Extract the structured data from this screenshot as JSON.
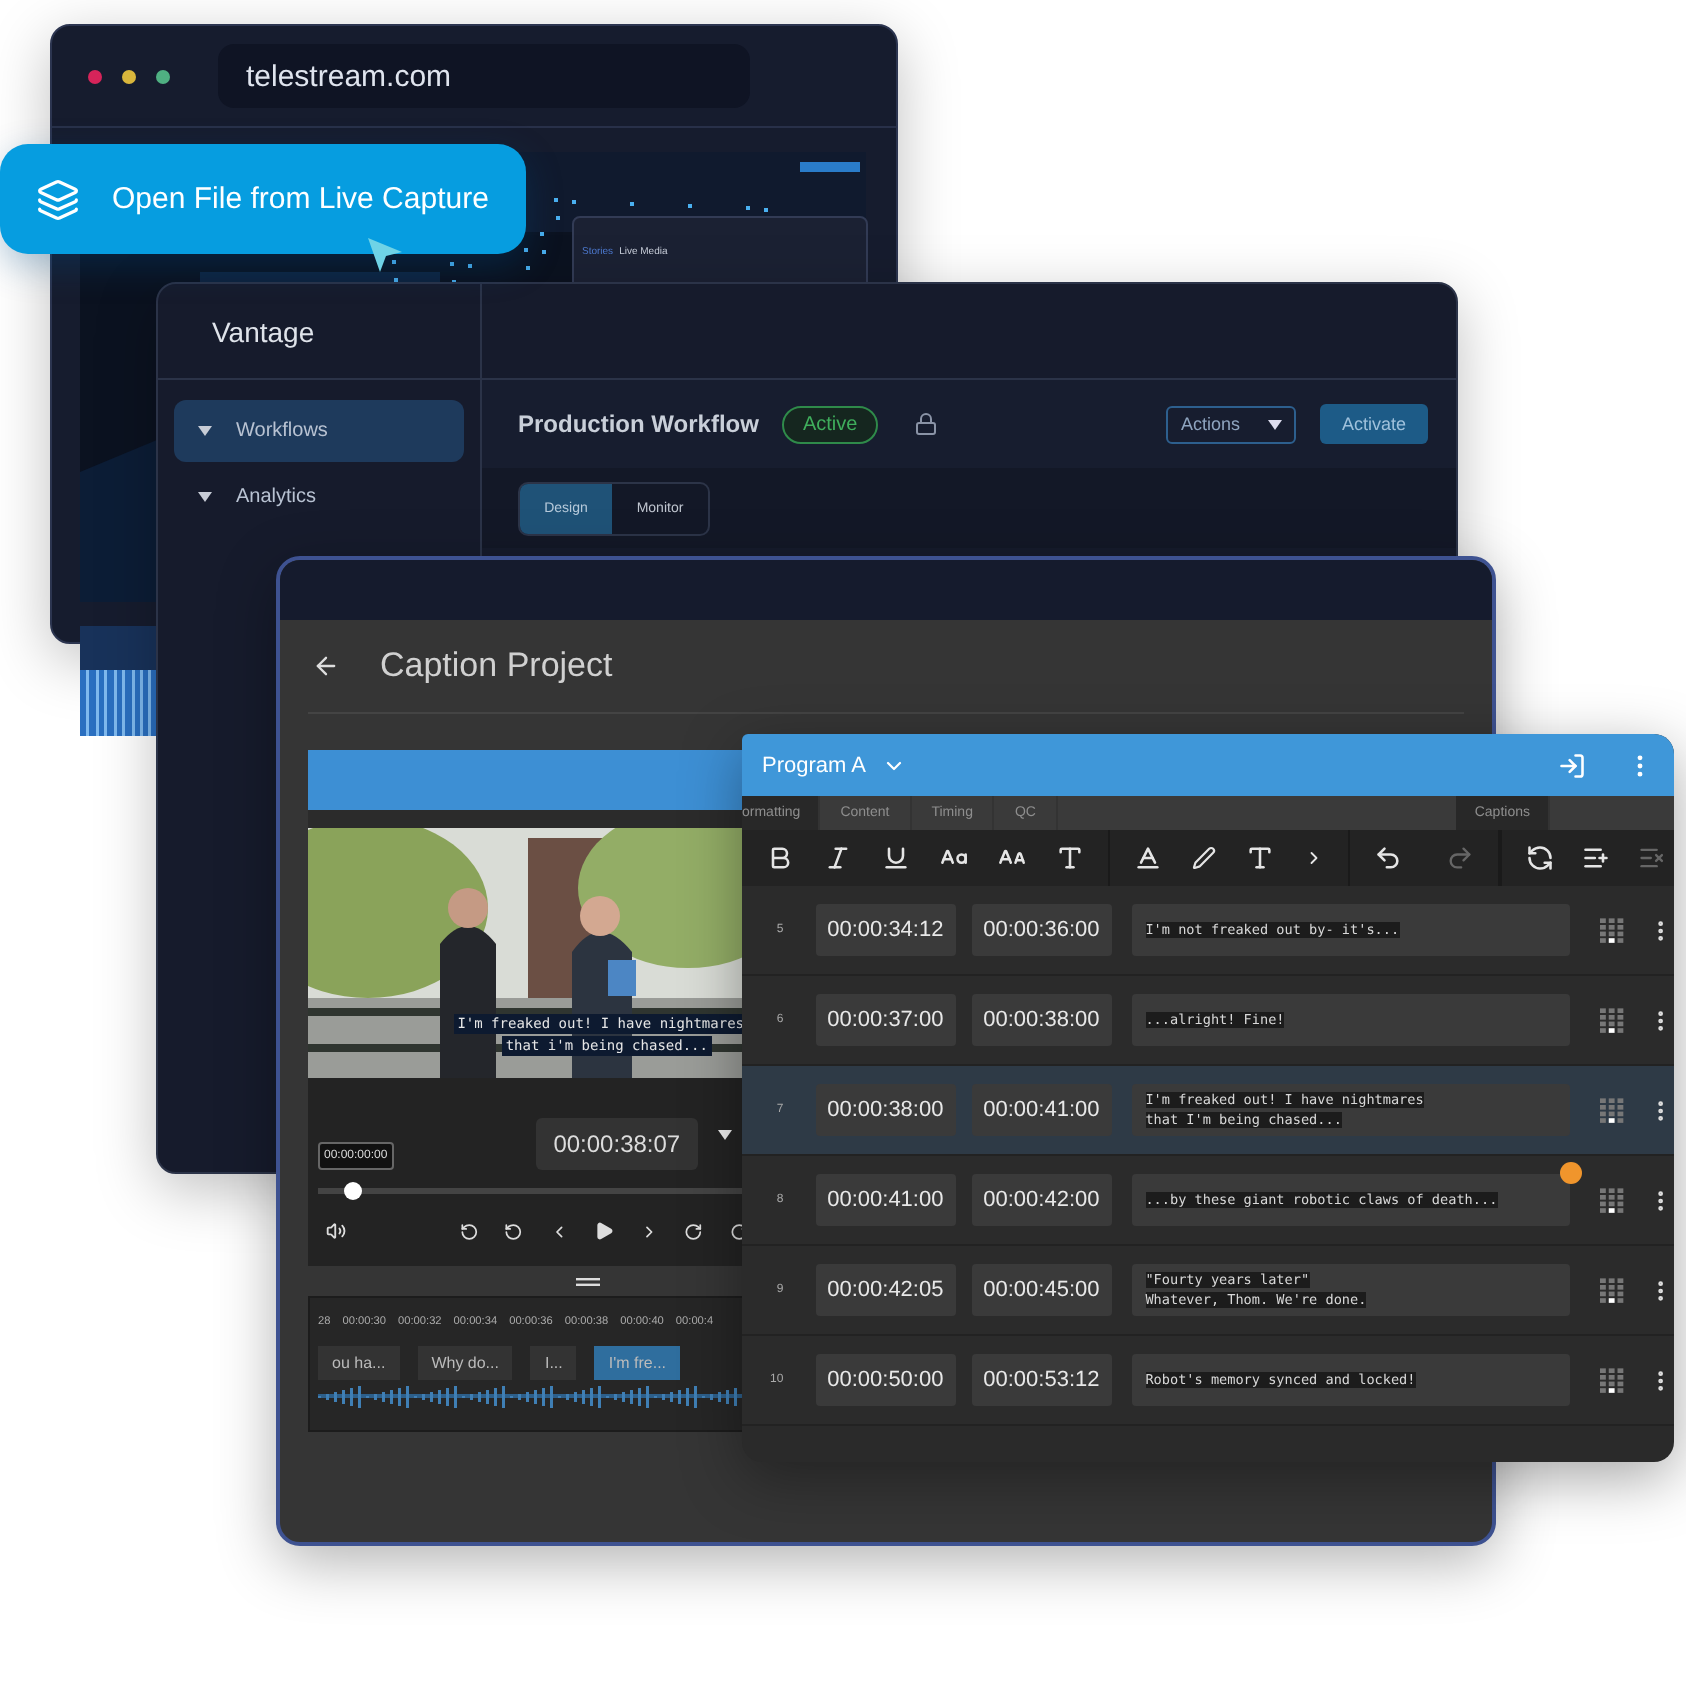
{
  "browser": {
    "url": "telestream.com",
    "breadcrumb": [
      "Stories",
      "Live Media"
    ]
  },
  "callout": {
    "label": "Open File from Live Capture"
  },
  "vantage": {
    "title": "Vantage",
    "sidebar": [
      {
        "label": "Workflows",
        "selected": true
      },
      {
        "label": "Analytics",
        "selected": false
      }
    ],
    "workflow_title": "Production Workflow",
    "status": "Active",
    "actions": "Actions",
    "activate": "Activate",
    "tabs": [
      {
        "label": "Design",
        "selected": true
      },
      {
        "label": "Monitor",
        "selected": false
      }
    ]
  },
  "caption_project": {
    "title": "Caption Project",
    "overlay": [
      "I'm freaked out! I have nightmares",
      "that i'm being chased..."
    ],
    "start_timecode": "00:00:00:00",
    "current_timecode": "00:00:38:07",
    "scrub": {
      "level": 0.08
    },
    "ticks": [
      "28",
      "00:00:30",
      "00:00:32",
      "00:00:34",
      "00:00:36",
      "00:00:38",
      "00:00:40",
      "00:00:4"
    ],
    "clips": [
      {
        "label": "ou ha...",
        "selected": false
      },
      {
        "label": "Why do...",
        "selected": false
      },
      {
        "label": "I...",
        "selected": false
      },
      {
        "label": "I'm fre...",
        "selected": true
      }
    ]
  },
  "program": {
    "name": "Program A",
    "tabs": [
      {
        "label": "ormatting",
        "selected": true
      },
      {
        "label": "Content",
        "selected": false
      },
      {
        "label": "Timing",
        "selected": false
      },
      {
        "label": "QC",
        "selected": false
      }
    ],
    "side_tab": {
      "label": "Captions",
      "selected": true
    },
    "rows": [
      {
        "index": "5",
        "start": "00:00:34:12",
        "end": "00:00:36:00",
        "lines": [
          "I'm not freaked out by- it's..."
        ],
        "selected": false,
        "warning": false
      },
      {
        "index": "6",
        "start": "00:00:37:00",
        "end": "00:00:38:00",
        "lines": [
          "...alright! Fine!"
        ],
        "selected": false,
        "warning": false
      },
      {
        "index": "7",
        "start": "00:00:38:00",
        "end": "00:00:41:00",
        "lines": [
          "I'm freaked out! I have nightmares",
          "that I'm being chased..."
        ],
        "selected": true,
        "warning": false
      },
      {
        "index": "8",
        "start": "00:00:41:00",
        "end": "00:00:42:00",
        "lines": [
          "...by these giant robotic claws of death..."
        ],
        "selected": false,
        "warning": true
      },
      {
        "index": "9",
        "start": "00:00:42:05",
        "end": "00:00:45:00",
        "lines": [
          "\"Fourty years later\"",
          "Whatever, Thom. We're done."
        ],
        "selected": false,
        "warning": false
      },
      {
        "index": "10",
        "start": "00:00:50:00",
        "end": "00:00:53:12",
        "lines": [
          "Robot's memory synced and locked!"
        ],
        "selected": false,
        "warning": false
      }
    ]
  }
}
